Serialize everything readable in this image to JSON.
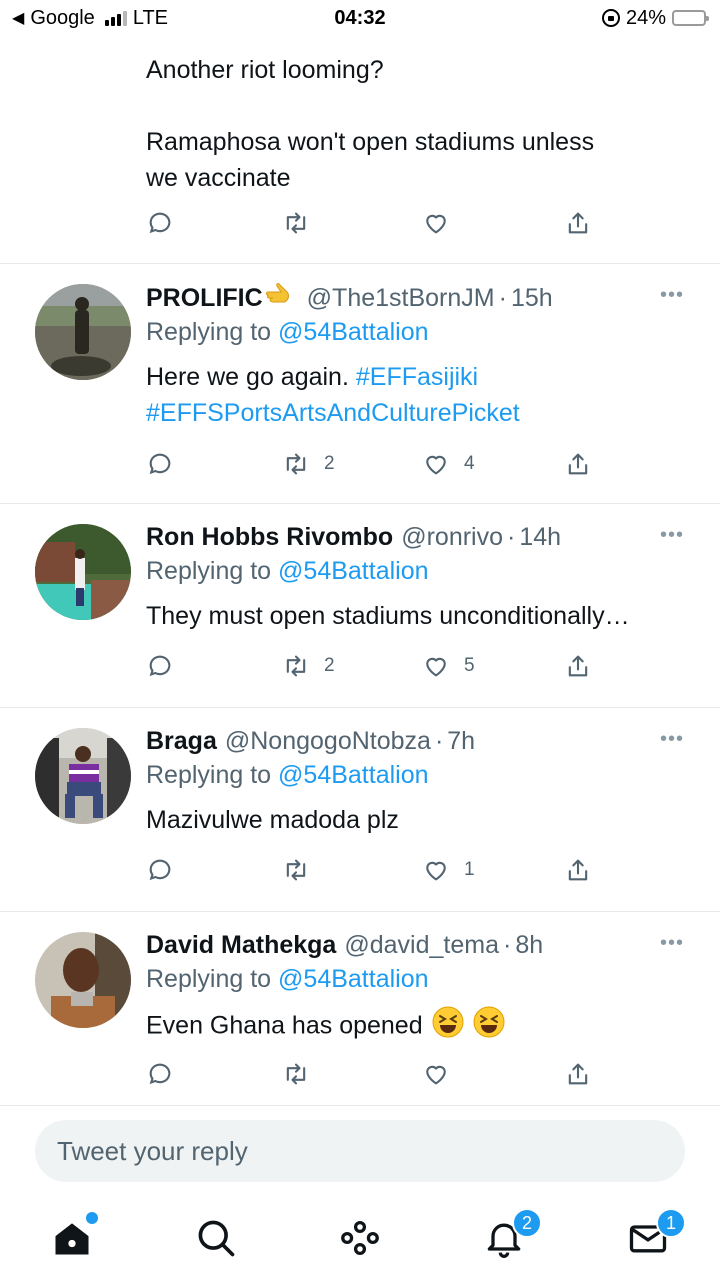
{
  "status_bar": {
    "back_label": "Google",
    "network": "LTE",
    "time": "04:32",
    "battery": "24%",
    "battery_fraction": 0.24
  },
  "top_tweet": {
    "line1": "Another riot looming?",
    "line2": "Ramaphosa won't open stadiums unless",
    "line3": "we vaccinate"
  },
  "tweets": [
    {
      "name": "PROLIFIC",
      "name_emoji": "backhand-index-pointing-left",
      "handle": "@The1stBornJM",
      "dot": "·",
      "time": "15h",
      "replying_prefix": "Replying to",
      "replying_to": "@54Battalion",
      "text": "Here we go again.",
      "hashtag1": "#EFFasijiki",
      "hashtag2": "#EFFSPortsArtsAndCulturePicket",
      "retweets": "2",
      "likes": "4"
    },
    {
      "name": "Ron Hobbs Rivombo",
      "handle": "@ronrivo",
      "dot": "·",
      "time": "14h",
      "replying_prefix": "Replying to",
      "replying_to": "@54Battalion",
      "text": "They must open stadiums unconditionally…",
      "retweets": "2",
      "likes": "5"
    },
    {
      "name": "Braga",
      "handle": "@NongogoNtobza",
      "dot": "·",
      "time": "7h",
      "replying_prefix": "Replying to",
      "replying_to": "@54Battalion",
      "text": "Mazivulwe madoda plz",
      "retweets": "",
      "likes": "1"
    },
    {
      "name": "David Mathekga",
      "handle": "@david_tema",
      "dot": "·",
      "time": "8h",
      "replying_prefix": "Replying to",
      "replying_to": "@54Battalion",
      "text": "Even Ghana has opened",
      "text_emojis": [
        "grinning-squinting-face",
        "grinning-squinting-face"
      ],
      "retweets": "",
      "likes": ""
    }
  ],
  "more_label": "•••",
  "reply_box": {
    "placeholder": "Tweet your reply"
  },
  "bottom_nav": {
    "items": [
      "home-icon",
      "search-icon",
      "spaces-icon",
      "notifications-icon",
      "messages-icon"
    ],
    "notifications_badge": "2",
    "messages_badge": "1"
  },
  "colors": {
    "accent": "#1d9bf0",
    "text": "#0f1419",
    "secondary": "#536471",
    "divider": "#e7e9ea"
  }
}
